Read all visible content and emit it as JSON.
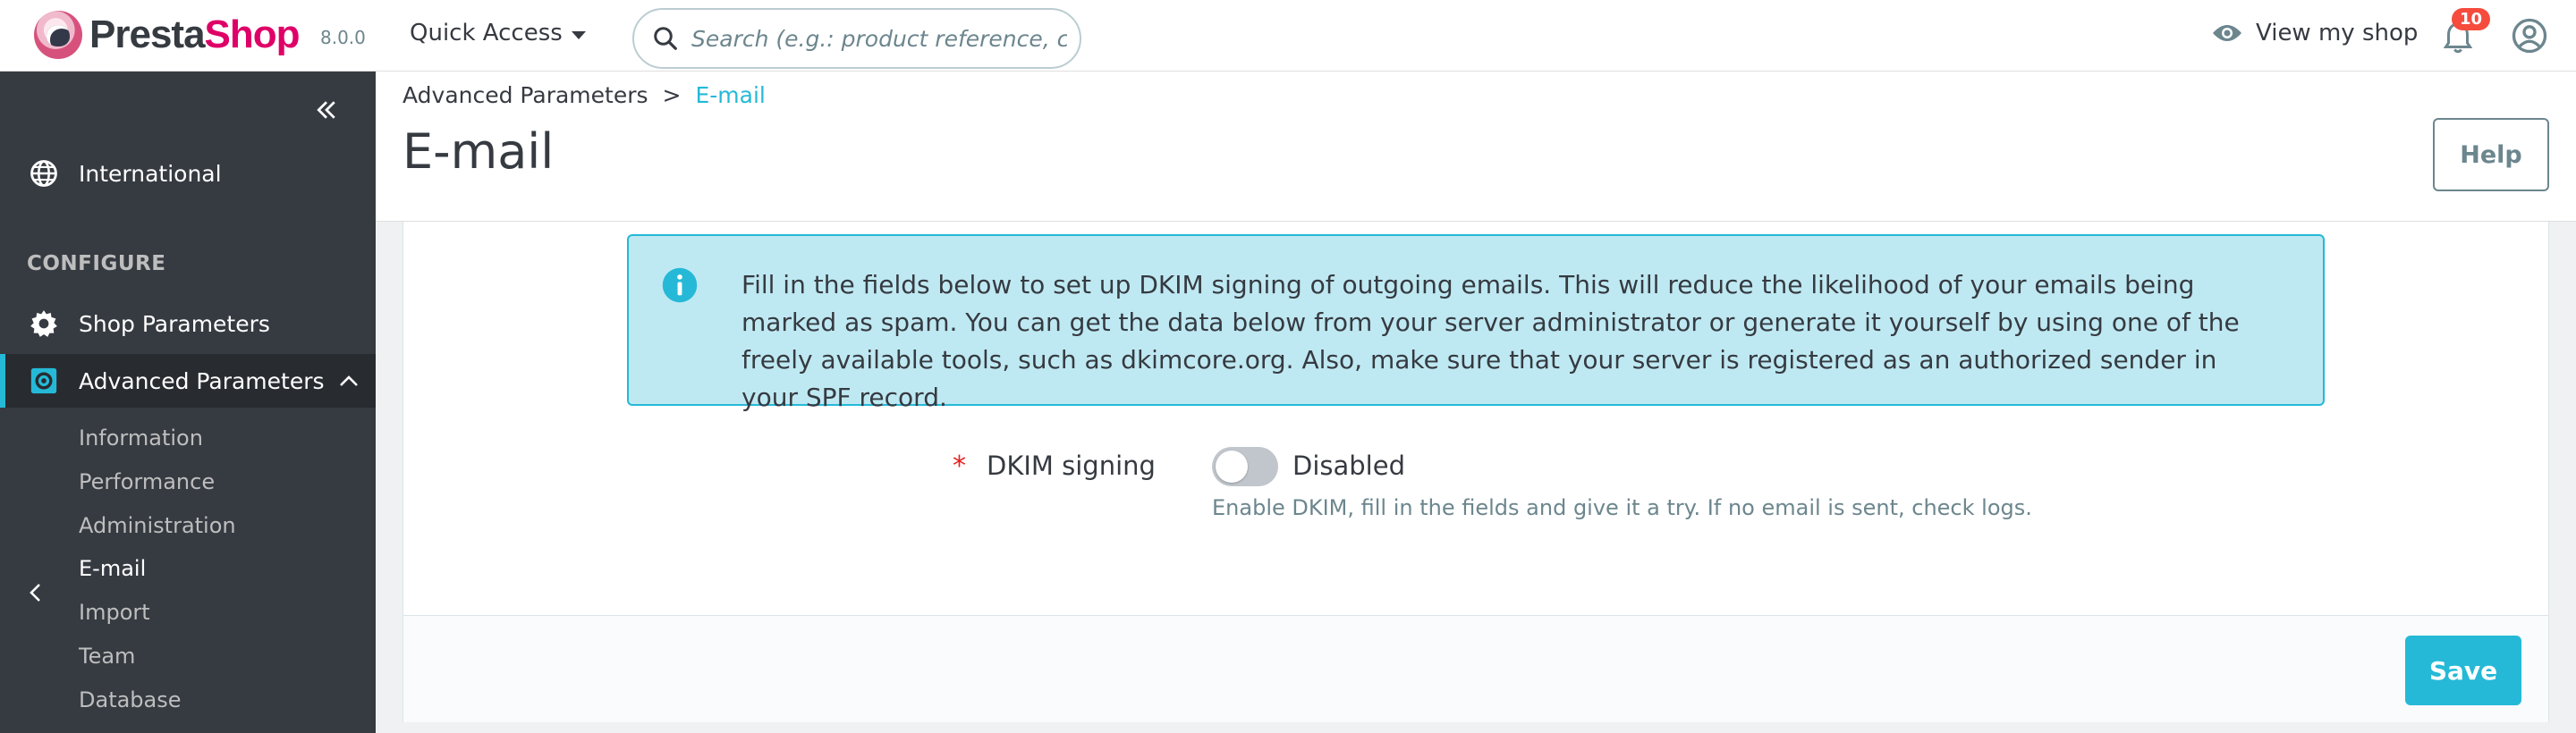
{
  "header": {
    "brand_presta": "Presta",
    "brand_shop": "Shop",
    "version": "8.0.0",
    "quick_access": "Quick Access",
    "search_placeholder": "Search (e.g.: product reference, custon",
    "view_my_shop": "View my shop",
    "notifications_count": "10"
  },
  "sidebar": {
    "international": "International",
    "section_configure": "CONFIGURE",
    "shop_parameters": "Shop Parameters",
    "advanced_parameters": "Advanced Parameters",
    "sub_items": [
      "Information",
      "Performance",
      "Administration",
      "E-mail",
      "Import",
      "Team",
      "Database"
    ],
    "active_sub_item": "E-mail"
  },
  "page_head": {
    "breadcrumb_parent": "Advanced Parameters",
    "breadcrumb_separator": ">",
    "breadcrumb_current": "E-mail",
    "title": "E-mail",
    "help_label": "Help"
  },
  "card": {
    "alert_text": "Fill in the fields below to set up DKIM signing of outgoing emails. This will reduce the likelihood of your emails being marked as spam. You can get the data below from your server administrator or generate it yourself by using one of the freely available tools, such as dkimcore.org. Also, make sure that your server is registered as an authorized sender in your SPF record.",
    "required_mark": "*",
    "dkim_label": "DKIM signing",
    "dkim_state": "Disabled",
    "dkim_help": "Enable DKIM, fill in the fields and give it a try. If no email is sent, check logs.",
    "save_label": "Save"
  },
  "colors": {
    "accent": "#25b9d7",
    "brand_pink": "#df0067",
    "sidebar_bg": "#363a41",
    "alert_bg": "#bfe9f2",
    "badge": "#f54c3e"
  },
  "icons": {
    "search": "search-icon",
    "view_shop": "eye-icon",
    "notifications": "bell-icon",
    "profile": "user-circle-icon",
    "international": "globe-icon",
    "shop_parameters": "gear-icon",
    "advanced_parameters": "settings-box-icon",
    "alert": "info-icon"
  }
}
